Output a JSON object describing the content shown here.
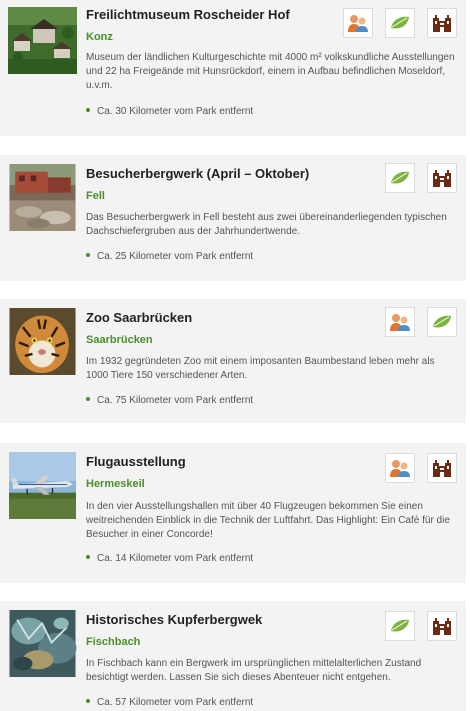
{
  "colors": {
    "accent_green": "#4a8f2a",
    "castle_brown": "#6b2a14",
    "card_bg": "#f3f3f3"
  },
  "attractions": [
    {
      "title": "Freilichtmuseum Roscheider Hof",
      "location": "Konz",
      "description": "Museum der ländlichen Kulturgeschichte mit 4000 m² volkskundliche Ausstellungen und 22 ha Freigeände mit Hunsrückdorf, einem in Aufbau befindlichen Moseldorf, u.v.m.",
      "distance": "Ca. 30 Kilometer vom Park entfernt",
      "icons": [
        "family-icon",
        "leaf-icon",
        "castle-icon"
      ]
    },
    {
      "title": "Besucherbergwerk (April – Oktober)",
      "location": "Fell",
      "description": "Das Besucherbergwerk in Fell besteht aus zwei übereinanderliegenden typischen Dachschiefergruben aus der Jahrhundertwende.",
      "distance": "Ca. 25 Kilometer vom Park entfernt",
      "icons": [
        "leaf-icon",
        "castle-icon"
      ]
    },
    {
      "title": "Zoo Saarbrücken",
      "location": "Saarbrücken",
      "description": "Im 1932 gegründeten Zoo mit einem imposanten Baumbestand leben mehr als 1000 Tiere 150 verschiedener Arten.",
      "distance": "Ca. 75 Kilometer vom Park entfernt",
      "icons": [
        "family-icon",
        "leaf-icon"
      ]
    },
    {
      "title": "Flugausstellung",
      "location": "Hermeskeil",
      "description": "In den vier Ausstellungshallen mit über 40 Flugzeugen bekommen Sie einen weitreichenden Einblick in die Technik der Luftfahrt. Das Highlight: Ein Café für die Besucher in einer Concorde!",
      "distance": "Ca. 14 Kilometer vom Park entfernt",
      "icons": [
        "family-icon",
        "castle-icon"
      ]
    },
    {
      "title": "Historisches Kupferbergwek",
      "location": "Fischbach",
      "description": "In Fischbach kann ein Bergwerk im ursprünglichen mittelalterlichen Zustand besichtigt werden. Lassen Sie sich dieses Abenteuer nicht entgehen.",
      "distance": "Ca. 57 Kilometer vom Park entfernt",
      "icons": [
        "leaf-icon",
        "castle-icon"
      ]
    }
  ]
}
